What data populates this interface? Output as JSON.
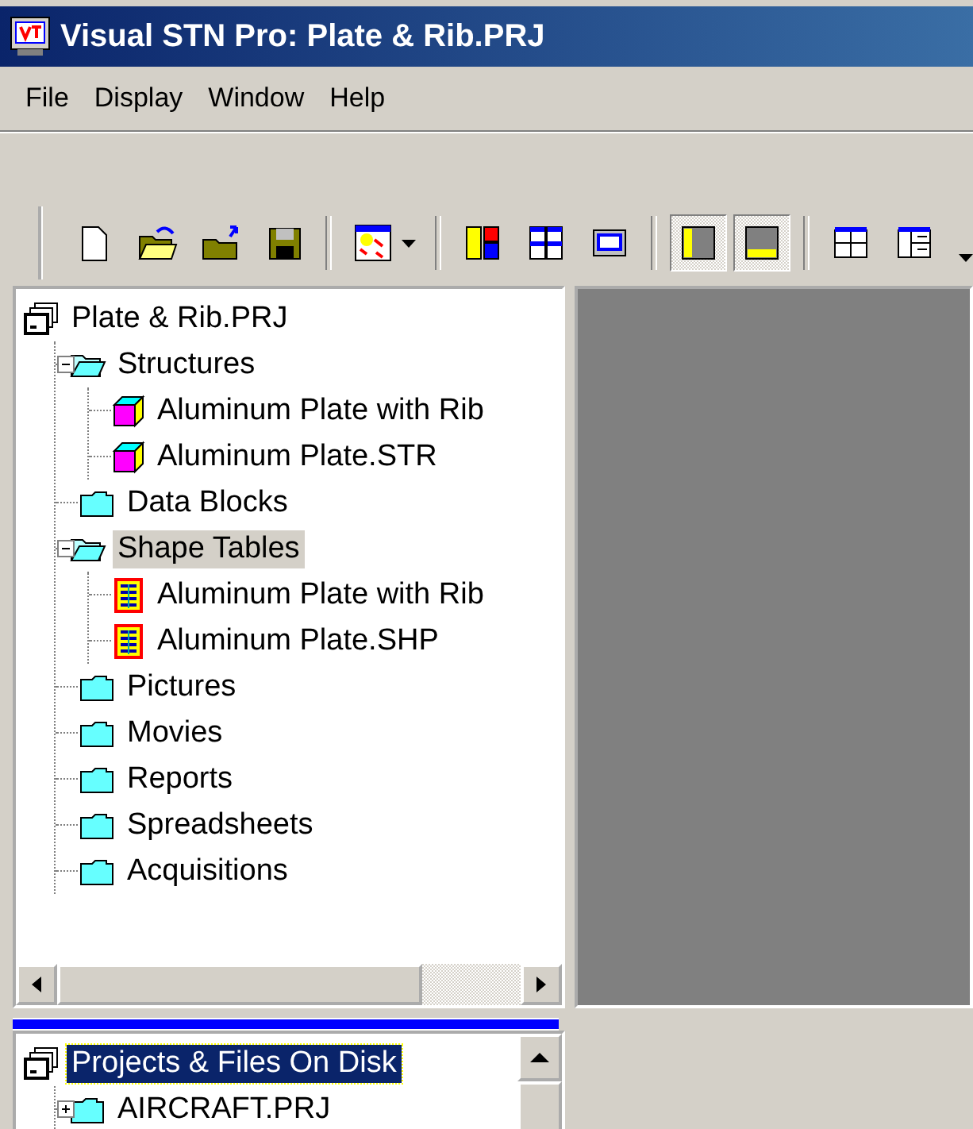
{
  "window": {
    "title": "Visual STN Pro: Plate & Rib.PRJ"
  },
  "menu": [
    "File",
    "Display",
    "Window",
    "Help"
  ],
  "toolbar": {
    "groups": [
      [
        {
          "kind": "new",
          "pressed": false
        },
        {
          "kind": "open",
          "pressed": false
        },
        {
          "kind": "open-up",
          "pressed": false
        },
        {
          "kind": "save",
          "pressed": false
        }
      ],
      [
        {
          "kind": "palette",
          "pressed": false
        }
      ],
      [
        {
          "kind": "split-columns",
          "pressed": false
        },
        {
          "kind": "quad",
          "pressed": false
        },
        {
          "kind": "window",
          "pressed": false
        }
      ],
      [
        {
          "kind": "left-pane",
          "pressed": true
        },
        {
          "kind": "bottom-pane",
          "pressed": true
        }
      ],
      [
        {
          "kind": "grid",
          "pressed": false
        },
        {
          "kind": "grid-side",
          "pressed": false
        }
      ]
    ]
  },
  "project_tree": {
    "label": "Plate & Rib.PRJ",
    "kind": "project",
    "selected": false,
    "children": [
      {
        "label": "Structures",
        "kind": "folder",
        "expanded": true,
        "selected": false,
        "children": [
          {
            "label": "Aluminum Plate with Rib",
            "kind": "structure",
            "selected": false
          },
          {
            "label": "Aluminum Plate.STR",
            "kind": "structure",
            "selected": false
          }
        ]
      },
      {
        "label": "Data Blocks",
        "kind": "folder",
        "expanded": false,
        "selected": false
      },
      {
        "label": "Shape Tables",
        "kind": "folder",
        "expanded": true,
        "selected": true,
        "children": [
          {
            "label": "Aluminum Plate with Rib",
            "kind": "table",
            "selected": false
          },
          {
            "label": "Aluminum Plate.SHP",
            "kind": "table",
            "selected": false
          }
        ]
      },
      {
        "label": "Pictures",
        "kind": "folder",
        "expanded": false,
        "selected": false
      },
      {
        "label": "Movies",
        "kind": "folder",
        "expanded": false,
        "selected": false
      },
      {
        "label": "Reports",
        "kind": "folder",
        "expanded": false,
        "selected": false
      },
      {
        "label": "Spreadsheets",
        "kind": "folder",
        "expanded": false,
        "selected": false
      },
      {
        "label": "Acquisitions",
        "kind": "folder",
        "expanded": false,
        "selected": false
      }
    ]
  },
  "disk_tree": {
    "label": "Projects & Files On Disk",
    "kind": "project",
    "selected": true,
    "children": [
      {
        "label": "AIRCRAFT.PRJ",
        "kind": "folder",
        "expanded": false,
        "collapsible": true,
        "selected": false
      }
    ]
  }
}
